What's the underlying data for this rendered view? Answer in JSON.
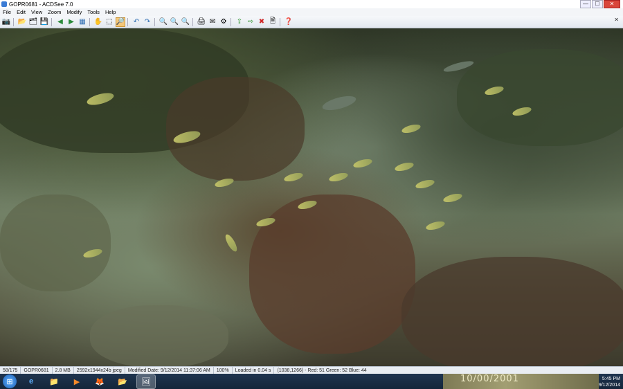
{
  "window": {
    "title": "GOPR0681 - ACDSee 7.0"
  },
  "menu": [
    "File",
    "Edit",
    "View",
    "Zoom",
    "Modify",
    "Tools",
    "Help"
  ],
  "toolbar": {
    "icons": [
      "acquire-icon",
      "open-icon",
      "browse-icon",
      "save-icon",
      "previous-icon",
      "next-icon",
      "slideshow-icon",
      "hand-tool-icon",
      "select-tool-icon",
      "zoom-tool-icon",
      "rotate-left-icon",
      "rotate-right-icon",
      "zoom-in-icon",
      "zoom-out-icon",
      "zoom-fit-icon",
      "print-icon",
      "email-icon",
      "tools-icon",
      "copy-to-icon",
      "move-to-icon",
      "delete-icon",
      "properties-icon",
      "help-icon"
    ]
  },
  "status": {
    "position": "58/175",
    "filename": "GOPR0681",
    "size": "2.8 MB",
    "dims": "2592x1944x24b jpeg",
    "modified": "Modified Date: 9/12/2014 11:37:06 AM",
    "zoom": "100%",
    "load": "Loaded in 0.04 s",
    "pixel": "(1038,1266) - Red: 51 Green: 52 Blue: 44"
  },
  "taskbar": {
    "apps": [
      "start-button",
      "internet-explorer-icon",
      "file-explorer-icon",
      "media-player-icon",
      "firefox-icon",
      "folder-icon",
      "acdsee-icon"
    ],
    "time": "5:45 PM",
    "date": "9/12/2014",
    "overlay_text": "10/00/2001"
  }
}
